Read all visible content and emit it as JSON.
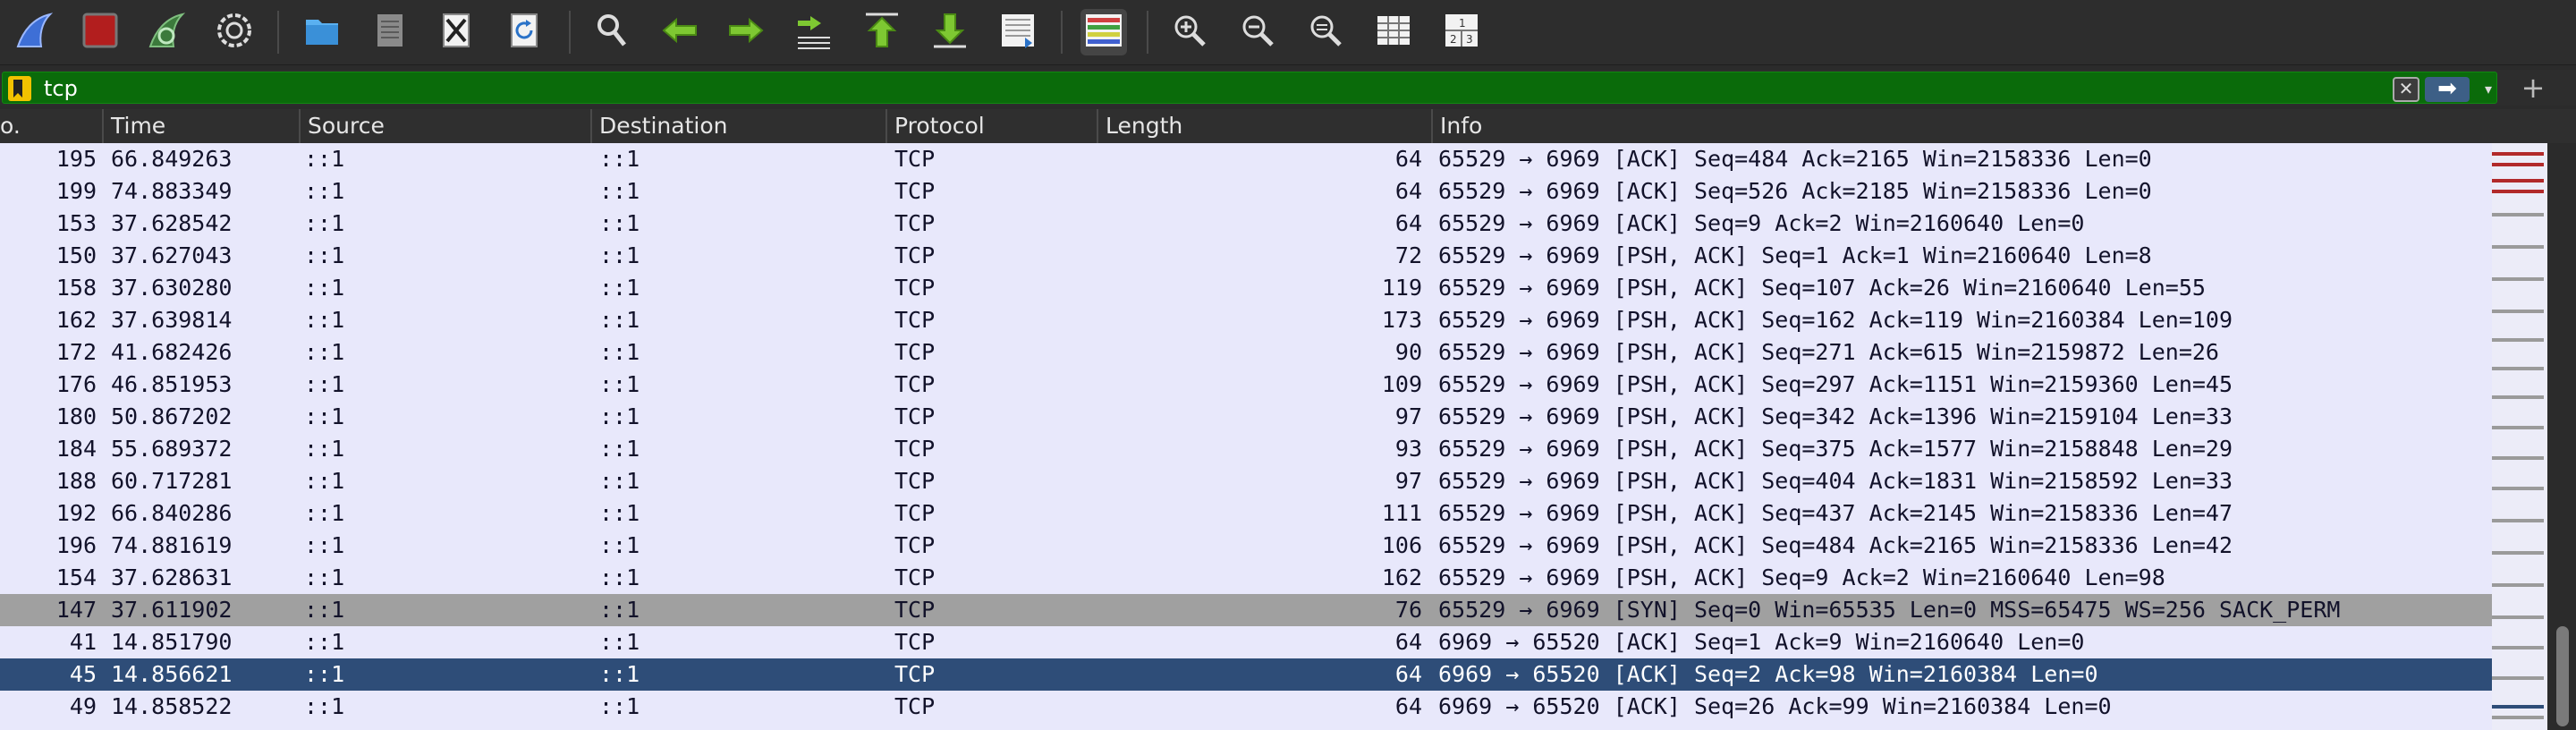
{
  "toolbar": {
    "buttons": [
      {
        "name": "start-capture",
        "icon": "shark-fin-icon"
      },
      {
        "name": "stop-capture",
        "icon": "stop-square-icon"
      },
      {
        "name": "restart-capture",
        "icon": "restart-fin-icon"
      },
      {
        "name": "capture-options",
        "icon": "gear-icon"
      },
      {
        "name": "open-file",
        "icon": "folder-icon"
      },
      {
        "name": "save-file",
        "icon": "file-icon"
      },
      {
        "name": "close-file",
        "icon": "close-file-icon"
      },
      {
        "name": "reload-file",
        "icon": "reload-icon"
      },
      {
        "name": "find-packet",
        "icon": "magnifier-icon"
      },
      {
        "name": "go-back",
        "icon": "arrow-left-icon"
      },
      {
        "name": "go-forward",
        "icon": "arrow-right-icon"
      },
      {
        "name": "go-to-packet",
        "icon": "go-to-packet-icon"
      },
      {
        "name": "go-first",
        "icon": "arrow-up-icon"
      },
      {
        "name": "go-last",
        "icon": "arrow-down-icon"
      },
      {
        "name": "autoscroll",
        "icon": "autoscroll-icon"
      },
      {
        "name": "colorize",
        "icon": "colorize-icon"
      },
      {
        "name": "zoom-in",
        "icon": "zoom-in-icon"
      },
      {
        "name": "zoom-out",
        "icon": "zoom-out-icon"
      },
      {
        "name": "zoom-reset",
        "icon": "zoom-reset-icon"
      },
      {
        "name": "resize-columns",
        "icon": "resize-columns-icon"
      },
      {
        "name": "layout",
        "icon": "layout-icon"
      }
    ]
  },
  "filter": {
    "value": "tcp",
    "clear_glyph": "✕",
    "apply_glyph": "➡",
    "dropdown_glyph": "▾",
    "add_glyph": "+"
  },
  "columns": [
    "o.",
    "Time",
    "Source",
    "Destination",
    "Protocol",
    "Length",
    "Info"
  ],
  "colors": {
    "row_default_bg": "#e8e8fb",
    "row_default_fg": "#12122a",
    "row_syn_bg": "#a0a0a0",
    "row_selected_bg": "#2e4d78",
    "row_selected_fg": "#ffffff",
    "filter_bg": "#0a6b0a"
  },
  "packets": [
    {
      "no": "195",
      "time": "66.849263",
      "source": "::1",
      "destination": "::1",
      "protocol": "TCP",
      "length": "64",
      "info": "65529 → 6969 [ACK] Seq=484 Ack=2165 Win=2158336 Len=0",
      "style": "normal"
    },
    {
      "no": "199",
      "time": "74.883349",
      "source": "::1",
      "destination": "::1",
      "protocol": "TCP",
      "length": "64",
      "info": "65529 → 6969 [ACK] Seq=526 Ack=2185 Win=2158336 Len=0",
      "style": "normal"
    },
    {
      "no": "153",
      "time": "37.628542",
      "source": "::1",
      "destination": "::1",
      "protocol": "TCP",
      "length": "64",
      "info": "65529 → 6969 [ACK] Seq=9 Ack=2 Win=2160640 Len=0",
      "style": "normal"
    },
    {
      "no": "150",
      "time": "37.627043",
      "source": "::1",
      "destination": "::1",
      "protocol": "TCP",
      "length": "72",
      "info": "65529 → 6969 [PSH, ACK] Seq=1 Ack=1 Win=2160640 Len=8",
      "style": "normal"
    },
    {
      "no": "158",
      "time": "37.630280",
      "source": "::1",
      "destination": "::1",
      "protocol": "TCP",
      "length": "119",
      "info": "65529 → 6969 [PSH, ACK] Seq=107 Ack=26 Win=2160640 Len=55",
      "style": "normal"
    },
    {
      "no": "162",
      "time": "37.639814",
      "source": "::1",
      "destination": "::1",
      "protocol": "TCP",
      "length": "173",
      "info": "65529 → 6969 [PSH, ACK] Seq=162 Ack=119 Win=2160384 Len=109",
      "style": "normal"
    },
    {
      "no": "172",
      "time": "41.682426",
      "source": "::1",
      "destination": "::1",
      "protocol": "TCP",
      "length": "90",
      "info": "65529 → 6969 [PSH, ACK] Seq=271 Ack=615 Win=2159872 Len=26",
      "style": "normal"
    },
    {
      "no": "176",
      "time": "46.851953",
      "source": "::1",
      "destination": "::1",
      "protocol": "TCP",
      "length": "109",
      "info": "65529 → 6969 [PSH, ACK] Seq=297 Ack=1151 Win=2159360 Len=45",
      "style": "normal"
    },
    {
      "no": "180",
      "time": "50.867202",
      "source": "::1",
      "destination": "::1",
      "protocol": "TCP",
      "length": "97",
      "info": "65529 → 6969 [PSH, ACK] Seq=342 Ack=1396 Win=2159104 Len=33",
      "style": "normal"
    },
    {
      "no": "184",
      "time": "55.689372",
      "source": "::1",
      "destination": "::1",
      "protocol": "TCP",
      "length": "93",
      "info": "65529 → 6969 [PSH, ACK] Seq=375 Ack=1577 Win=2158848 Len=29",
      "style": "normal"
    },
    {
      "no": "188",
      "time": "60.717281",
      "source": "::1",
      "destination": "::1",
      "protocol": "TCP",
      "length": "97",
      "info": "65529 → 6969 [PSH, ACK] Seq=404 Ack=1831 Win=2158592 Len=33",
      "style": "normal"
    },
    {
      "no": "192",
      "time": "66.840286",
      "source": "::1",
      "destination": "::1",
      "protocol": "TCP",
      "length": "111",
      "info": "65529 → 6969 [PSH, ACK] Seq=437 Ack=2145 Win=2158336 Len=47",
      "style": "normal"
    },
    {
      "no": "196",
      "time": "74.881619",
      "source": "::1",
      "destination": "::1",
      "protocol": "TCP",
      "length": "106",
      "info": "65529 → 6969 [PSH, ACK] Seq=484 Ack=2165 Win=2158336 Len=42",
      "style": "normal"
    },
    {
      "no": "154",
      "time": "37.628631",
      "source": "::1",
      "destination": "::1",
      "protocol": "TCP",
      "length": "162",
      "info": "65529 → 6969 [PSH, ACK] Seq=9 Ack=2 Win=2160640 Len=98",
      "style": "normal"
    },
    {
      "no": "147",
      "time": "37.611902",
      "source": "::1",
      "destination": "::1",
      "protocol": "TCP",
      "length": "76",
      "info": "65529 → 6969 [SYN] Seq=0 Win=65535 Len=0 MSS=65475 WS=256 SACK_PERM",
      "style": "syn"
    },
    {
      "no": "41",
      "time": "14.851790",
      "source": "::1",
      "destination": "::1",
      "protocol": "TCP",
      "length": "64",
      "info": "6969 → 65520 [ACK] Seq=1 Ack=9 Win=2160640 Len=0",
      "style": "normal"
    },
    {
      "no": "45",
      "time": "14.856621",
      "source": "::1",
      "destination": "::1",
      "protocol": "TCP",
      "length": "64",
      "info": "6969 → 65520 [ACK] Seq=2 Ack=98 Win=2160384 Len=0",
      "style": "selected"
    },
    {
      "no": "49",
      "time": "14.858522",
      "source": "::1",
      "destination": "::1",
      "protocol": "TCP",
      "length": "64",
      "info": "6969 → 65520 [ACK] Seq=26 Ack=99 Win=2160384 Len=0",
      "style": "normal"
    }
  ]
}
